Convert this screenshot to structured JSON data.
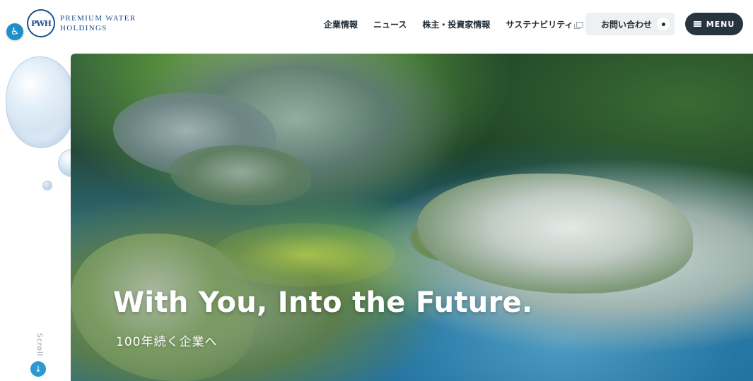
{
  "header": {
    "logo_mark": "PWH",
    "logo_line1": "Premium Water",
    "logo_line2": "Holdings",
    "nav": [
      {
        "label": "企業情報"
      },
      {
        "label": "ニュース"
      },
      {
        "label": "株主・投資家情報"
      },
      {
        "label": "サステナビリティ",
        "external": true
      }
    ],
    "contact_label": "お問い合わせ",
    "menu_label": "MENU"
  },
  "hero": {
    "title": "With You, Into the Future.",
    "subtitle": "100年続く企業へ"
  },
  "scroll": {
    "label": "Scroll",
    "icon": "arrow-down-icon"
  },
  "icons": {
    "accessibility": "accessibility-icon",
    "external_link": "external-link-icon",
    "hamburger": "hamburger-icon"
  },
  "colors": {
    "brand": "#1d4f8a",
    "accent": "#2a9ad1",
    "menu_bg": "#26343e",
    "contact_bg": "#eef0f2"
  }
}
